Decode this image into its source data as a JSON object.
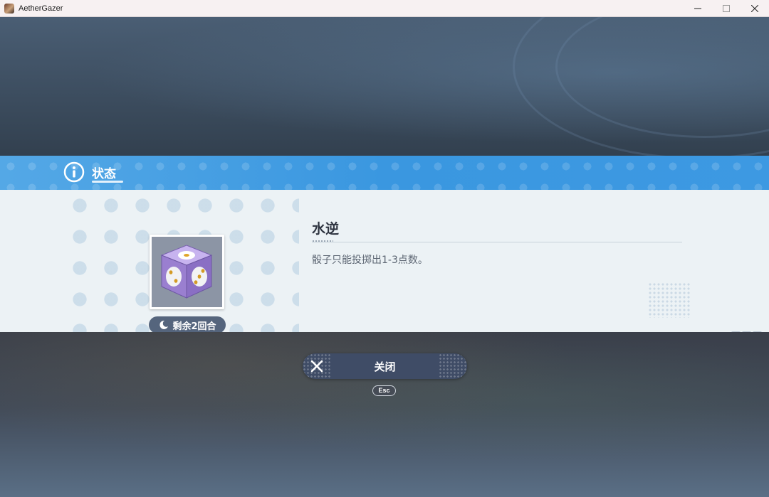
{
  "window": {
    "title": "AetherGazer",
    "icon": "app-icon",
    "controls": [
      "minimize-icon",
      "maximize-icon",
      "close-icon"
    ]
  },
  "banner": {
    "title": "状态",
    "icon": "info-icon"
  },
  "status": {
    "name": "水逆",
    "description": "骰子只能投掷出1-3点数。",
    "remaining": "剩余2回合",
    "image": "purple-dice",
    "remaining_icon": "moon-icon"
  },
  "actions": {
    "close_label": "关闭",
    "close_hint": "Esc"
  },
  "colors": {
    "banner_blue": "#3a97e0",
    "panel_bg": "#ecf2f5",
    "dice_purple": "#a48ad8",
    "button_bg": "#3f4c66"
  }
}
